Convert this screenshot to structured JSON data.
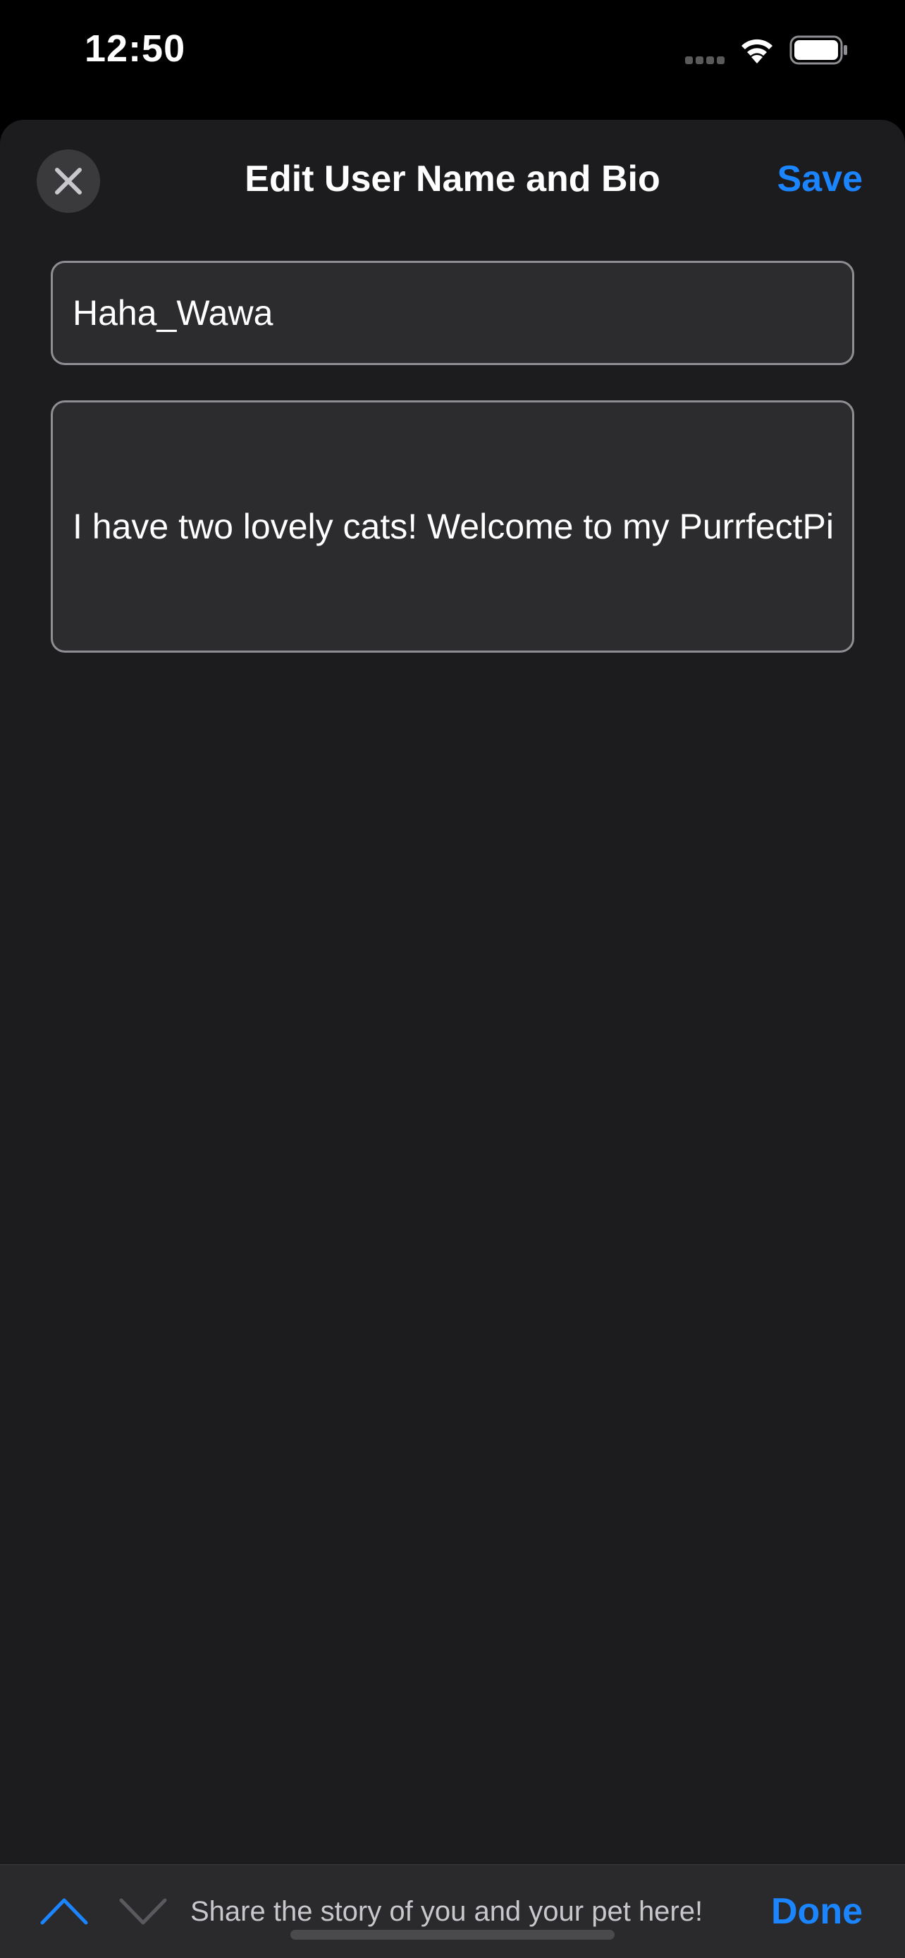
{
  "status_bar": {
    "time": "12:50"
  },
  "sheet": {
    "title": "Edit User Name and Bio",
    "save_label": "Save",
    "close_icon": "close-icon"
  },
  "form": {
    "username_value": "Haha_Wawa",
    "bio_value": "I have two lovely cats! Welcome to my PurrfectPi"
  },
  "toolbar": {
    "prev_icon": "chevron-up-icon",
    "next_icon": "chevron-down-icon",
    "hint": "Share the story of you and your pet here!",
    "done_label": "Done"
  },
  "colors": {
    "accent": "#1b84ff",
    "sheet_background": "#1c1c1e",
    "field_background": "#2c2c2e",
    "field_border": "#8e8e93"
  }
}
